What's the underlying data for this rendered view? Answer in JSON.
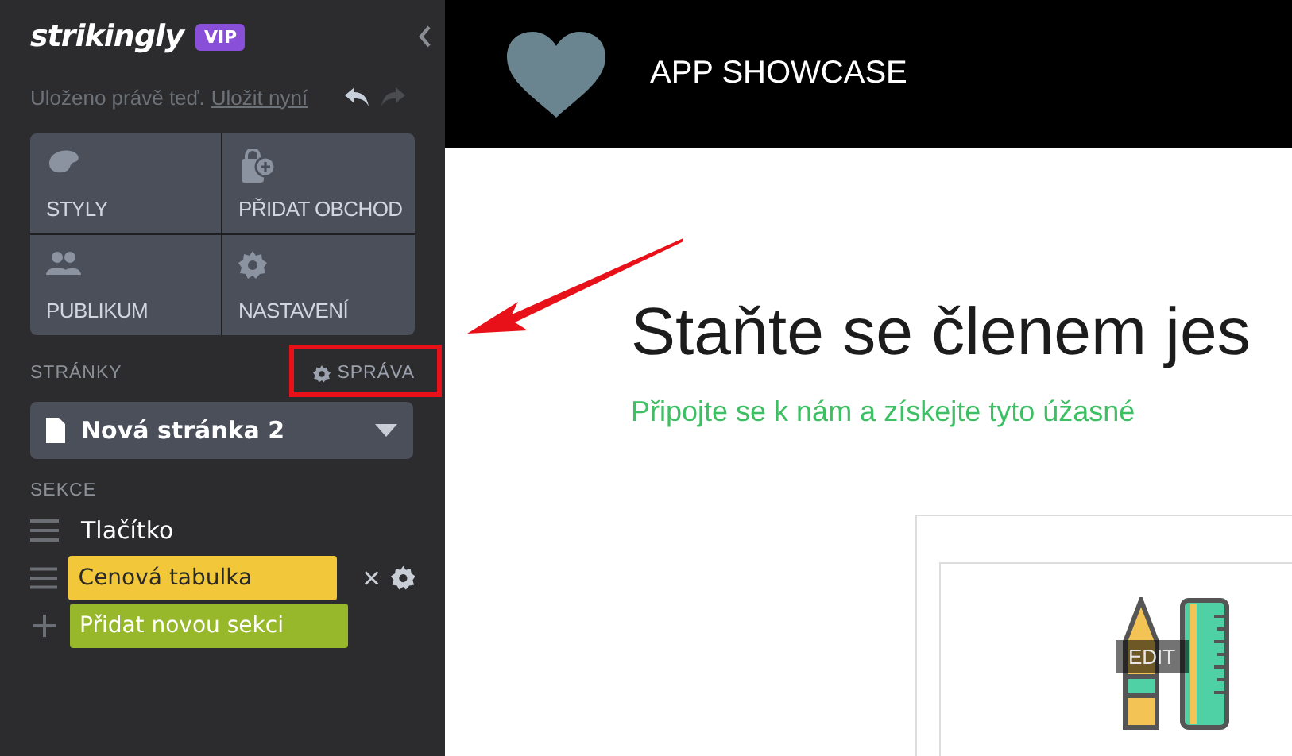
{
  "sidebar": {
    "logo": "strikingly",
    "badge": "VIP",
    "save_status": "Uloženo právě teď.",
    "save_link": "Uložit nyní",
    "tiles": [
      {
        "label": "STYLY",
        "kind": "palette"
      },
      {
        "label": "PŘIDAT OBCHOD",
        "kind": "shop"
      },
      {
        "label": "PUBLIKUM",
        "kind": "people"
      },
      {
        "label": "NASTAVENÍ",
        "kind": "gear"
      }
    ],
    "pages_label": "STRÁNKY",
    "manage_button": "SPRÁVA",
    "page_select": "Nová stránka 2",
    "sections_label": "SEKCE",
    "sections": [
      {
        "label": "Tlačítko",
        "kind": "plain"
      },
      {
        "label": "Cenová tabulka",
        "kind": "highlighted",
        "color": "#f2c73a"
      },
      {
        "label": "Přidat novou sekci",
        "kind": "add",
        "color": "#96b82a"
      }
    ]
  },
  "site": {
    "title": "APP SHOWCASE",
    "heading": "Staňte se členem jes",
    "subtitle": "Připojte se k nám a získejte tyto úžasné",
    "edit_label": "EDIT"
  }
}
